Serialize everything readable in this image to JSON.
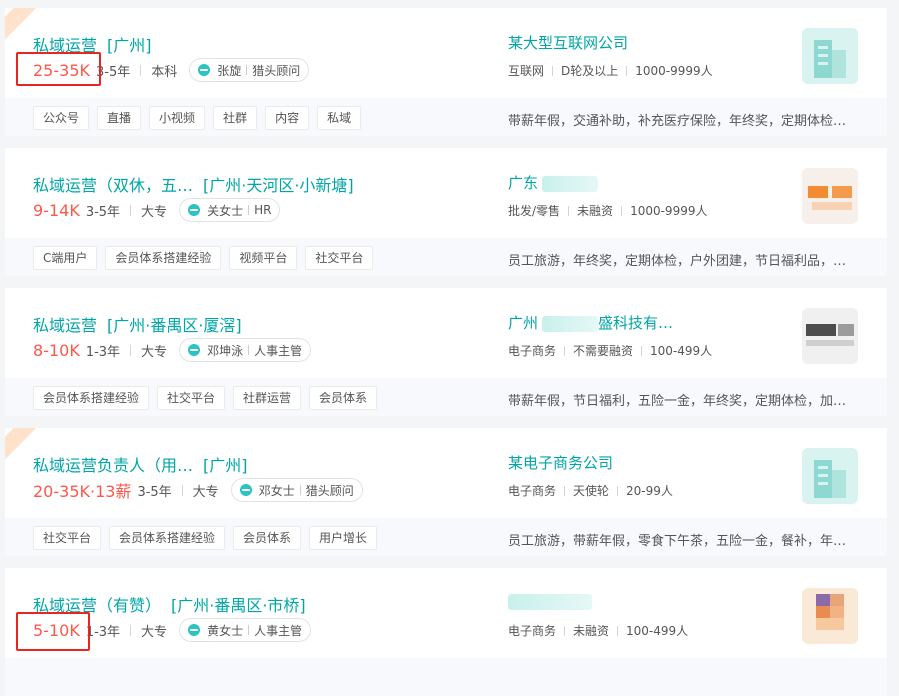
{
  "jobs": [
    {
      "title": "私域运营",
      "location": "[广州]",
      "salary": "25-35K",
      "experience": "3-5年",
      "education": "本科",
      "recruiter_name": "张旋",
      "recruiter_role": "猎头顾问",
      "skills": [
        "公众号",
        "直播",
        "小视频",
        "社群",
        "内容",
        "私域"
      ],
      "company_name": "某大型互联网公司",
      "company_industry": "互联网",
      "company_stage": "D轮及以上",
      "company_size": "1000-9999人",
      "welfare": "带薪年假，交通补助，补充医疗保险，年终奖，定期体检…",
      "logo": "building-logo-icon",
      "ribbon": true,
      "highlight_salary": true,
      "blurred_name": false
    },
    {
      "title": "私域运营（双休，五…",
      "location": "[广州·天河区·小新塘]",
      "salary": "9-14K",
      "experience": "3-5年",
      "education": "大专",
      "recruiter_name": "关女士",
      "recruiter_role": "HR",
      "skills": [
        "C端用户",
        "会员体系搭建经验",
        "视频平台",
        "社交平台"
      ],
      "company_name": "广东",
      "company_industry": "批发/零售",
      "company_stage": "未融资",
      "company_size": "1000-9999人",
      "welfare": "员工旅游，年终奖，定期体检，户外团建，节日福利品，…",
      "logo": "orange-logo-icon",
      "ribbon": false,
      "highlight_salary": false,
      "blurred_name": true
    },
    {
      "title": "私域运营",
      "location": "[广州·番禺区·厦滘]",
      "salary": "8-10K",
      "experience": "1-3年",
      "education": "大专",
      "recruiter_name": "邓坤泳",
      "recruiter_role": "人事主管",
      "skills": [
        "会员体系搭建经验",
        "社交平台",
        "社群运营",
        "会员体系"
      ],
      "company_name": "广州",
      "company_name_suffix": "盛科技有…",
      "company_industry": "电子商务",
      "company_stage": "不需要融资",
      "company_size": "100-499人",
      "welfare": "带薪年假，节日福利，五险一金，年终奖，定期体检，加…",
      "logo": "dark-logo-icon",
      "ribbon": false,
      "highlight_salary": false,
      "blurred_name": true
    },
    {
      "title": "私域运营负责人（用…",
      "location": "[广州]",
      "salary": "20-35K·13薪",
      "experience": "3-5年",
      "education": "大专",
      "recruiter_name": "邓女士",
      "recruiter_role": "猎头顾问",
      "skills": [
        "社交平台",
        "会员体系搭建经验",
        "会员体系",
        "用户增长"
      ],
      "company_name": "某电子商务公司",
      "company_industry": "电子商务",
      "company_stage": "天使轮",
      "company_size": "20-99人",
      "welfare": "员工旅游，带薪年假，零食下午茶，五险一金，餐补，年…",
      "logo": "building-logo-icon",
      "ribbon": true,
      "highlight_salary": false,
      "blurred_name": false
    },
    {
      "title": "私域运营（有赞）",
      "location": "[广州·番禺区·市桥]",
      "salary": "5-10K",
      "experience": "1-3年",
      "education": "大专",
      "recruiter_name": "黄女士",
      "recruiter_role": "人事主管",
      "skills": [],
      "company_name": "",
      "company_industry": "电子商务",
      "company_stage": "未融资",
      "company_size": "100-499人",
      "welfare": "",
      "logo": "mosaic-logo-icon",
      "ribbon": false,
      "highlight_salary": true,
      "blurred_name": true
    }
  ],
  "colors": {
    "accent": "#00a6a7",
    "salary": "#fe574a",
    "highlight": "#e8261f"
  }
}
